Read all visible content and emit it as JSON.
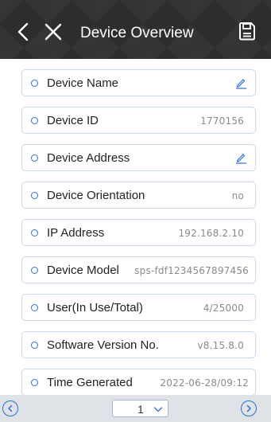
{
  "header": {
    "title": "Device Overview",
    "back_icon": "back-chevron-icon",
    "close_icon": "close-icon",
    "save_icon": "save-icon"
  },
  "colors": {
    "header_bg": "#2d2d2d",
    "accent": "#2b6fd6",
    "row_border": "#c9d7ef",
    "footer_bg": "#dfe2e7"
  },
  "rows": [
    {
      "label": "Device Name",
      "value": "",
      "editable": true
    },
    {
      "label": "Device ID",
      "value": "1770156",
      "editable": false
    },
    {
      "label": "Device Address",
      "value": "",
      "editable": true
    },
    {
      "label": "Device Orientation",
      "value": "no",
      "editable": false
    },
    {
      "label": " IP Address",
      "value": "192.168.2.10",
      "editable": false
    },
    {
      "label": "Device Model",
      "value": "sps-fdf1234567897456",
      "editable": false
    },
    {
      "label": "User(In Use/Total)",
      "value": "4/25000",
      "editable": false
    },
    {
      "label": "Software Version No.",
      "value": "v8.15.8.0",
      "editable": false
    },
    {
      "label": "Time Generated",
      "value": "2022-06-28/09:12",
      "editable": false
    }
  ],
  "pagination": {
    "current_page": "1",
    "prev_icon": "prev-circle-icon",
    "next_icon": "next-circle-icon"
  }
}
